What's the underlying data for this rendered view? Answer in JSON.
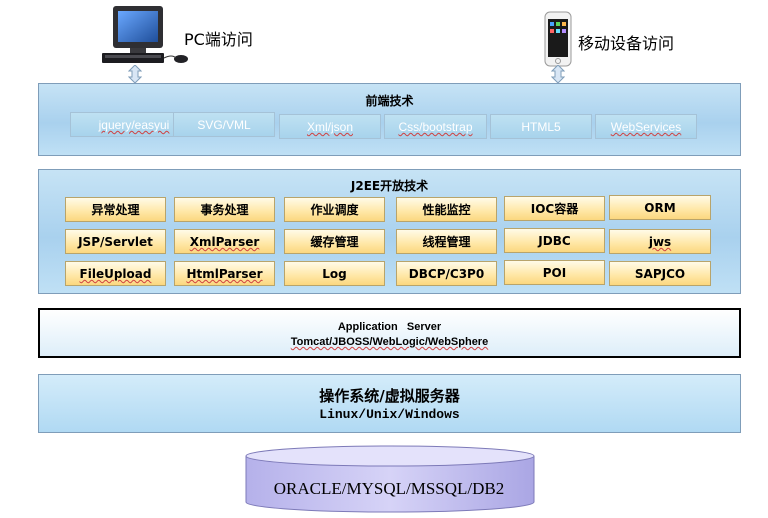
{
  "clients": {
    "pc_label": "PC端访问",
    "mobile_label": "移动设备访问"
  },
  "frontend": {
    "title": "前端技术",
    "items": [
      "jquery/easyui",
      "SVG/VML",
      "Xml/json",
      "Css/bootstrap",
      "HTML5",
      "WebServices"
    ]
  },
  "j2ee": {
    "title": "J2EE开放技术",
    "rows": [
      [
        "异常处理",
        "事务处理",
        "作业调度",
        "性能监控",
        "IOC容器",
        "ORM"
      ],
      [
        "JSP/Servlet",
        "XmlParser",
        "缓存管理",
        "线程管理",
        "JDBC",
        "jws"
      ],
      [
        "FileUpload",
        "HtmlParser",
        "Log",
        "DBCP/C3P0",
        "POI",
        "SAPJCO"
      ]
    ]
  },
  "app_server": {
    "line1": "Application   Server",
    "line2": "Tomcat/JBOSS/WebLogic/WebSphere"
  },
  "os": {
    "line1": "操作系统/虚拟服务器",
    "line2": "Linux/Unix/Windows"
  },
  "database": {
    "label": "ORACLE/MYSQL/MSSQL/DB2"
  },
  "colors": {
    "panel_border": "#7f9db9",
    "component_fill": "#ffe7a6",
    "db_fill": "#c9c6f0"
  }
}
